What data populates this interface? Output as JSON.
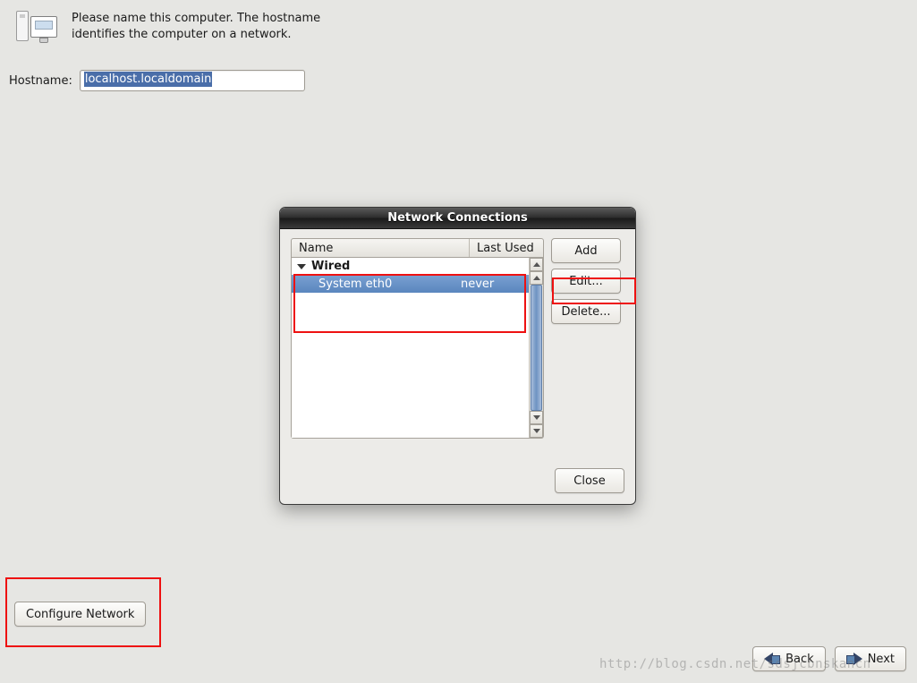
{
  "header": {
    "instructions": "Please name this computer.  The hostname identifies the computer on a network."
  },
  "hostname": {
    "label": "Hostname:",
    "value": "localhost.localdomain"
  },
  "configure_network_button": "Configure Network",
  "nav": {
    "back": "Back",
    "next": "Next"
  },
  "dialog": {
    "title": "Network Connections",
    "columns": {
      "name": "Name",
      "last_used": "Last Used"
    },
    "groups": [
      {
        "label": "Wired",
        "items": [
          {
            "name": "System eth0",
            "last_used": "never",
            "selected": true
          }
        ]
      }
    ],
    "buttons": {
      "add": "Add",
      "edit": "Edit...",
      "delete": "Delete...",
      "close": "Close"
    }
  },
  "watermark": "http://blog.csdn.net/sdsjcbnskancn"
}
